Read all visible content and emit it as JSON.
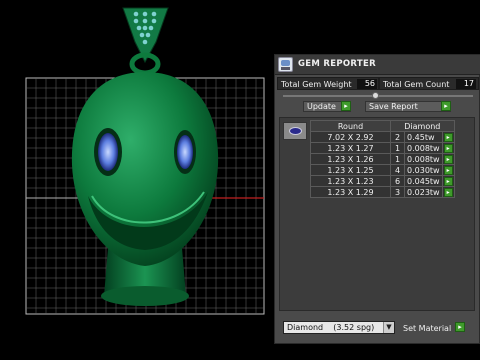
{
  "viewport": {
    "description_icon": "pendant-3d-model"
  },
  "panel": {
    "title": "GEM REPORTER",
    "total_weight_label": "Total Gem Weight",
    "total_weight_value": "56",
    "total_count_label": "Total Gem Count",
    "total_count_value": "17",
    "update_label": "Update",
    "save_report_label": "Save Report",
    "table": {
      "headers": [
        "Round",
        "Diamond"
      ],
      "rows": [
        {
          "size": "7.02 X 2.92",
          "count": "2",
          "weight": "0.45tw"
        },
        {
          "size": "1.23 X 1.27",
          "count": "1",
          "weight": "0.008tw"
        },
        {
          "size": "1.23 X 1.26",
          "count": "1",
          "weight": "0.008tw"
        },
        {
          "size": "1.23 X 1.25",
          "count": "4",
          "weight": "0.030tw"
        },
        {
          "size": "1.23 X 1.23",
          "count": "6",
          "weight": "0.045tw"
        },
        {
          "size": "1.23 X 1.29",
          "count": "3",
          "weight": "0.023tw"
        }
      ]
    },
    "material_select": "Diamond    (3.52 spg)",
    "set_material_label": "Set Material",
    "go_glyph": "▸"
  },
  "colors": {
    "go_green": "#3f9a2b",
    "model_green": "#0f7a3c",
    "gem_blue": "#6a8ee0"
  }
}
